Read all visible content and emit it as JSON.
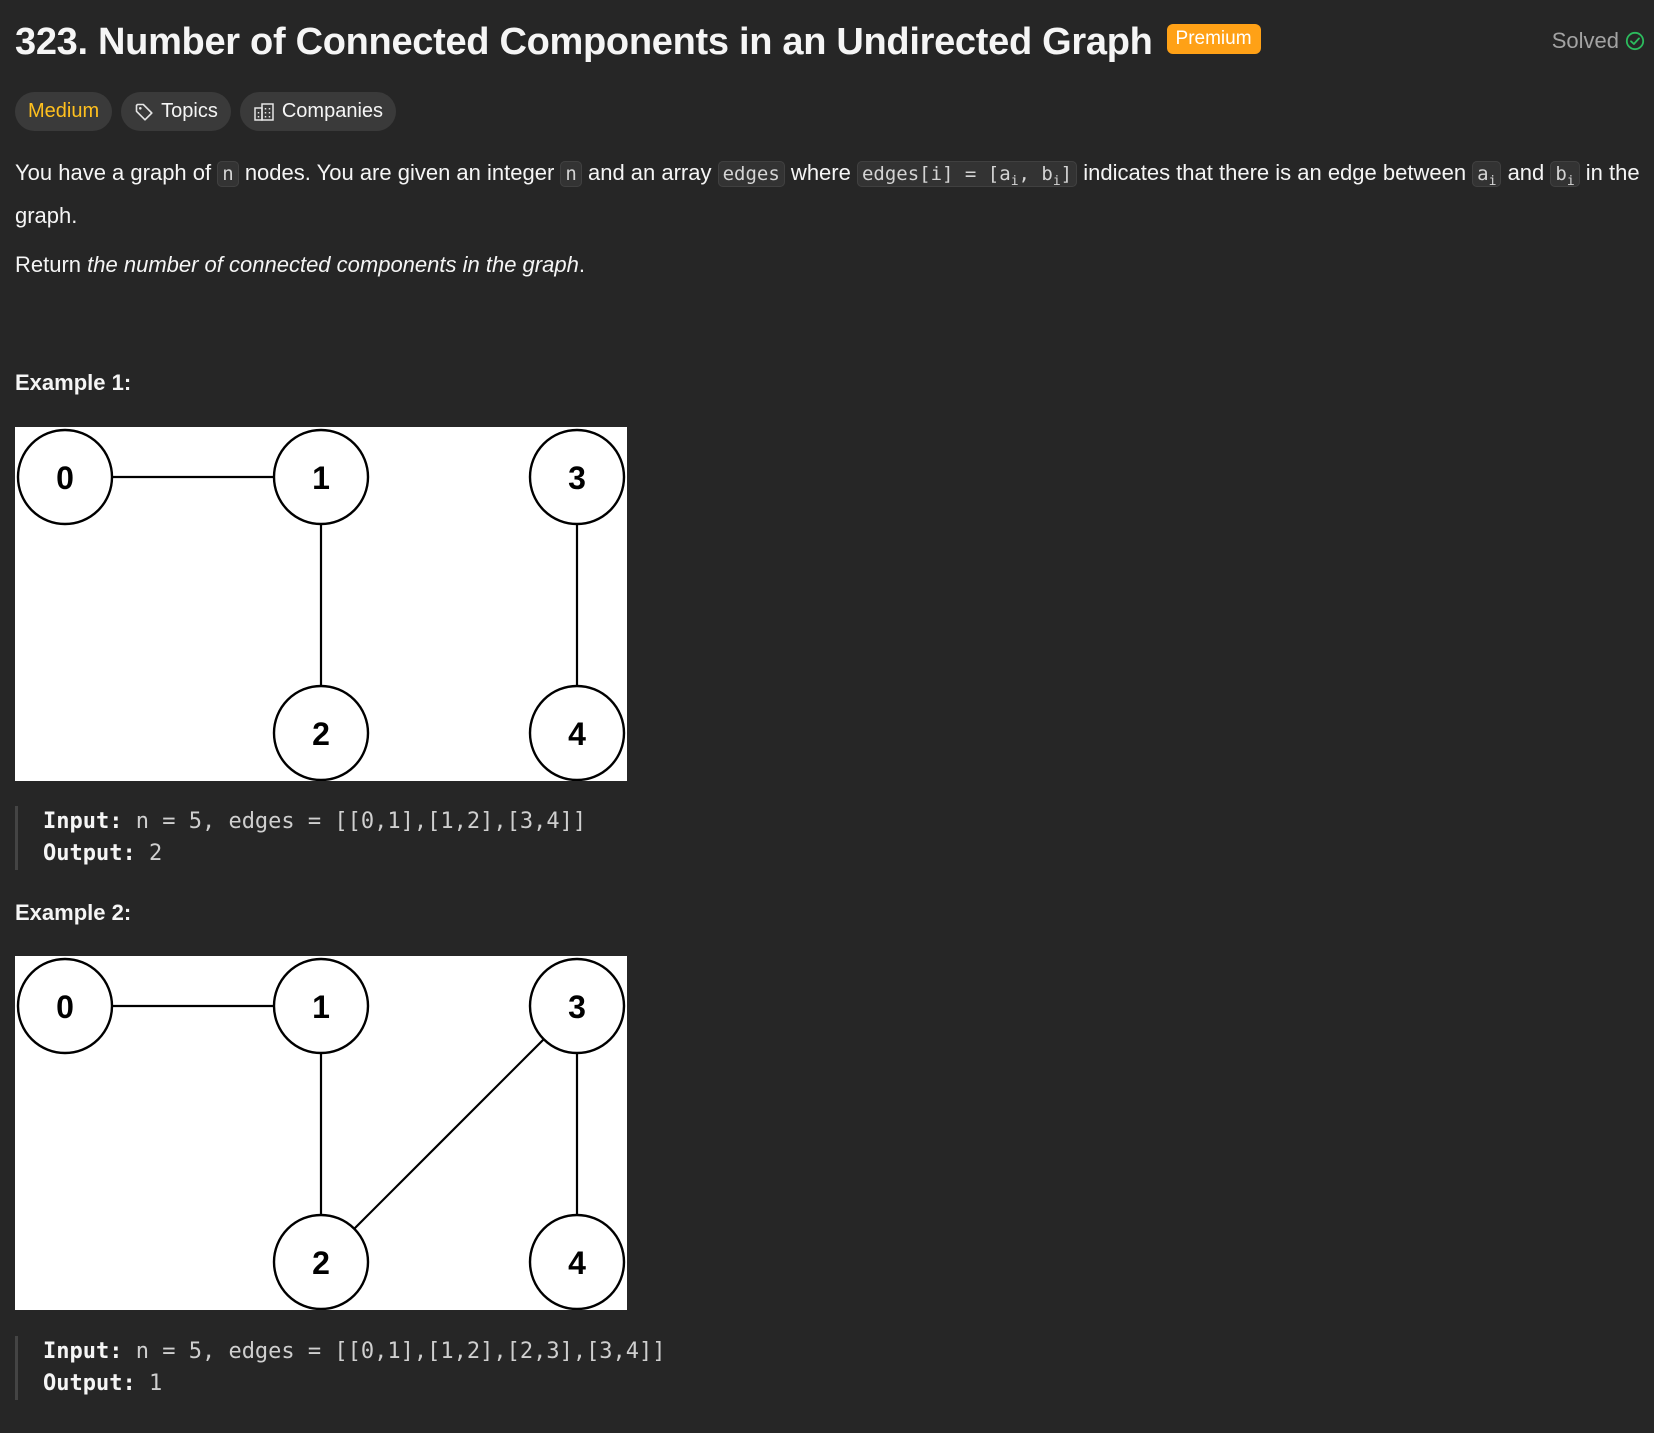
{
  "problem": {
    "title": "323. Number of Connected Components in an Undirected Graph",
    "premium_label": "Premium",
    "status": "Solved"
  },
  "tags": {
    "difficulty": "Medium",
    "topics": "Topics",
    "companies": "Companies"
  },
  "description": {
    "p1_a": "You have a graph of ",
    "code_n1": "n",
    "p1_b": " nodes. You are given an integer ",
    "code_n2": "n",
    "p1_c": " and an array ",
    "code_edges": "edges",
    "p1_d": " where ",
    "code_edges_i": "edges[i] = [a",
    "sub_i": "i",
    "code_edges_i_mid": ", b",
    "code_edges_i_end": "]",
    "p1_e": " indicates that there is an edge between ",
    "code_a": "a",
    "p1_f": " and ",
    "code_b": "b",
    "p1_g": " in the graph.",
    "p2_a": "Return ",
    "p2_em": "the number of connected components in the graph",
    "p2_b": "."
  },
  "examples": [
    {
      "title": "Example 1:",
      "input_label": "Input:",
      "input_value": " n = 5, edges = [[0,1],[1,2],[3,4]]",
      "output_label": "Output:",
      "output_value": " 2",
      "nodes": [
        "0",
        "1",
        "2",
        "3",
        "4"
      ]
    },
    {
      "title": "Example 2:",
      "input_label": "Input:",
      "input_value": " n = 5, edges = [[0,1],[1,2],[2,3],[3,4]]",
      "output_label": "Output:",
      "output_value": " 1",
      "nodes": [
        "0",
        "1",
        "2",
        "3",
        "4"
      ]
    }
  ],
  "colors": {
    "background": "#262626",
    "premium": "#ffa116",
    "medium": "#ffc01e",
    "solved_check": "#2cbb5d"
  }
}
